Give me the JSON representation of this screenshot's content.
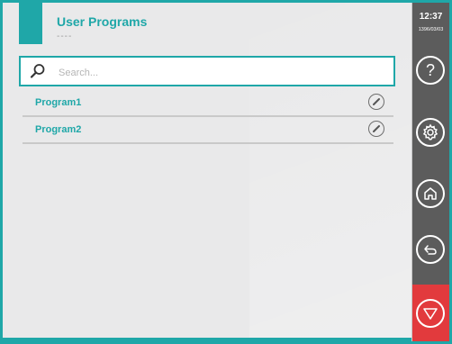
{
  "header": {
    "title": "User Programs",
    "subtitle": "----"
  },
  "search": {
    "placeholder": "Search...",
    "value": ""
  },
  "programs": [
    {
      "label": "Program1",
      "action_icon": "edit-icon"
    },
    {
      "label": "Program2",
      "action_icon": "edit-icon"
    }
  ],
  "sidebar": {
    "time": "12:37",
    "date": "1396/03/03",
    "help_label": "?",
    "buttons": [
      "help-icon",
      "settings-gear-icon",
      "home-icon",
      "back-icon"
    ],
    "stop_icon": "emergency-stop-icon"
  },
  "colors": {
    "accent": "#1fa7a8",
    "sidebar": "#5c5c5c",
    "stop": "#e23a3d",
    "background": "#e9e9ea"
  }
}
